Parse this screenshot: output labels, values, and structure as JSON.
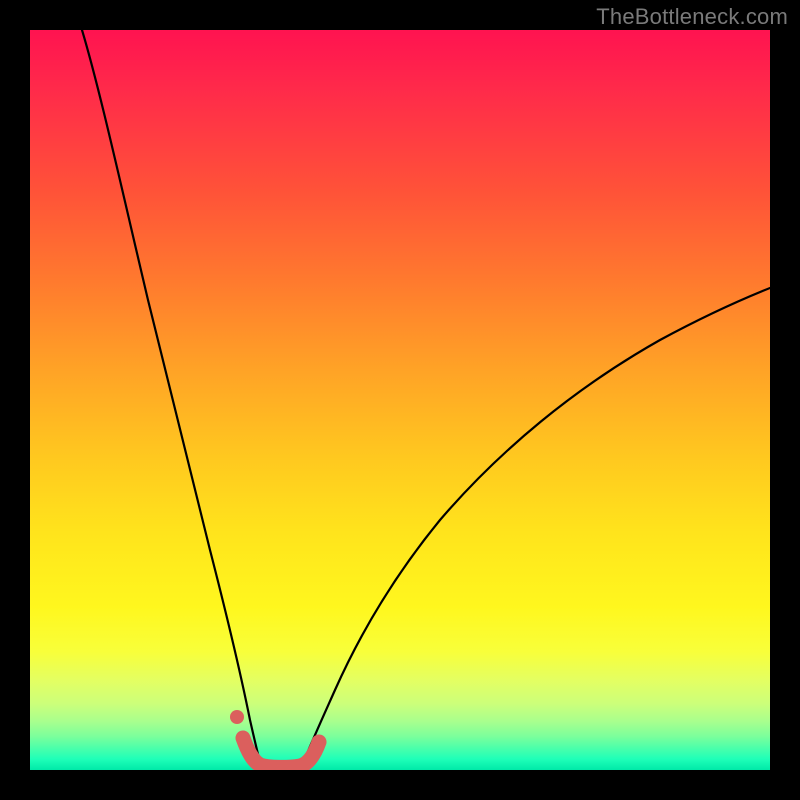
{
  "watermark": "TheBottleneck.com",
  "chart_data": {
    "type": "line",
    "title": "",
    "xlabel": "",
    "ylabel": "",
    "xlim": [
      0,
      100
    ],
    "ylim": [
      0,
      100
    ],
    "grid": false,
    "legend": false,
    "background_gradient": {
      "orientation": "vertical",
      "stops": [
        {
          "pos": 0.0,
          "color": "#ff1350"
        },
        {
          "pos": 0.5,
          "color": "#ffc91f"
        },
        {
          "pos": 0.8,
          "color": "#fff71e"
        },
        {
          "pos": 1.0,
          "color": "#00e9a8"
        }
      ],
      "note": "Background encodes bottleneck severity by vertical position (top=red=high, bottom=green=low); x-axis implicitly represents a hardware balance parameter."
    },
    "series": [
      {
        "name": "left-branch-curve",
        "style": "thin-black",
        "x": [
          7,
          10,
          13,
          16,
          19,
          21,
          23.5,
          25.5,
          27,
          28.5,
          29.5,
          30.2
        ],
        "y": [
          100,
          88,
          74,
          60,
          46,
          36,
          25,
          16,
          10,
          5,
          2,
          0.8
        ]
      },
      {
        "name": "right-branch-curve",
        "style": "thin-black",
        "x": [
          36.8,
          38,
          40,
          43,
          47,
          52,
          58,
          65,
          73,
          82,
          91,
          100
        ],
        "y": [
          0.8,
          2,
          6,
          12,
          19,
          26,
          33,
          40,
          47,
          53,
          58,
          63
        ]
      },
      {
        "name": "bottom-highlight",
        "style": "thick-red",
        "x": [
          28.5,
          29.2,
          30.2,
          32.0,
          34.0,
          36.0,
          37.0,
          37.8,
          38.5
        ],
        "y": [
          4.0,
          2.0,
          0.9,
          0.6,
          0.6,
          0.7,
          1.2,
          2.5,
          4.5
        ]
      },
      {
        "name": "isolated-dot",
        "style": "red-dot",
        "x": [
          27.8
        ],
        "y": [
          7.5
        ]
      }
    ],
    "annotations": []
  }
}
